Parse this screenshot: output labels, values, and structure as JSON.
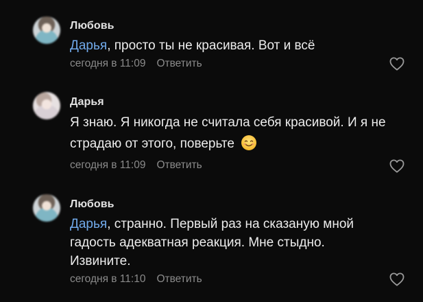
{
  "comments": [
    {
      "author": "Любовь",
      "mention": "Дарья",
      "text_after_mention": ", просто ты не красивая. Вот и всё",
      "time": "сегодня в 11:09",
      "reply_label": "Ответить"
    },
    {
      "author": "Дарья",
      "text_line1": "Я знаю. Я никогда не считала себя красивой. И я не",
      "text_line2": "страдаю от этого, поверьте",
      "emoji": "smiling-face-emoji",
      "time": "сегодня в 11:09",
      "reply_label": "Ответить"
    },
    {
      "author": "Любовь",
      "mention": "Дарья",
      "text_after_mention": ", странно. Первый раз на сказаную мной",
      "text_line2": "гадость адекватная реакция. Мне стыдно.",
      "text_line3": "Извините.",
      "time": "сегодня в 11:10",
      "reply_label": "Ответить"
    }
  ],
  "icons": {
    "like": "heart-icon"
  },
  "colors": {
    "background": "#0b0b0b",
    "mention": "#71aaeb",
    "meta": "#8b8b8b",
    "text": "#ececec"
  }
}
